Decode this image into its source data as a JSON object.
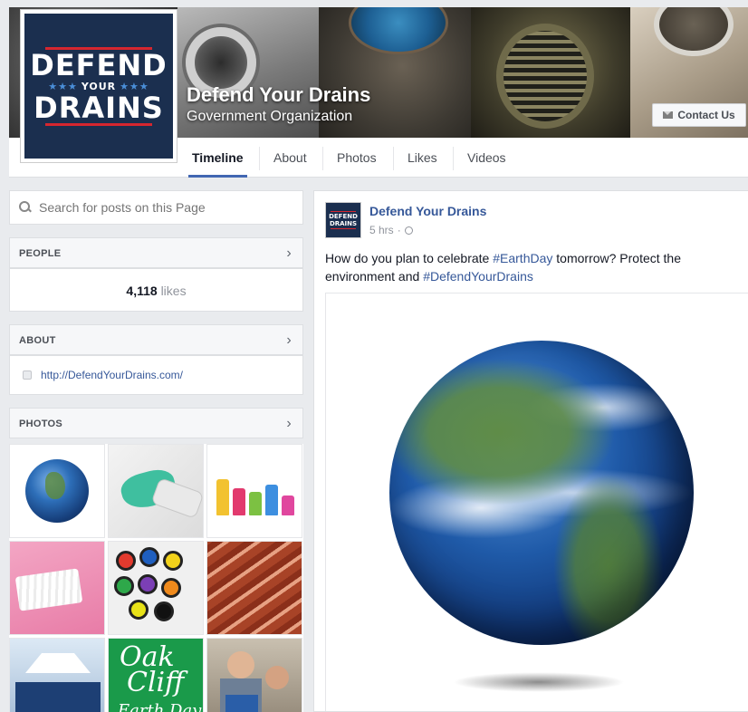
{
  "page": {
    "name": "Defend Your Drains",
    "category": "Government Organization",
    "contact_label": "Contact Us",
    "logo": {
      "line1": "DEFEND",
      "line2": "YOUR",
      "line3": "DRAINS",
      "stars": "★★★"
    }
  },
  "tabs": [
    {
      "label": "Timeline",
      "active": true
    },
    {
      "label": "About"
    },
    {
      "label": "Photos"
    },
    {
      "label": "Likes"
    },
    {
      "label": "Videos"
    }
  ],
  "sidebar": {
    "search_placeholder": "Search for posts on this Page",
    "people": {
      "title": "PEOPLE",
      "count": "4,118",
      "count_label": "likes"
    },
    "about": {
      "title": "ABOUT",
      "website": "http://DefendYourDrains.com/"
    },
    "photos": {
      "title": "PHOTOS",
      "oak_cliff": {
        "line1": "Oak",
        "line2": "Cliff",
        "line3": "Earth Day"
      }
    }
  },
  "post": {
    "author": "Defend Your Drains",
    "time": "5 hrs",
    "text_before": "How do you plan to celebrate ",
    "hashtag1": "#EarthDay",
    "text_middle": " tomorrow? Protect the environment and ",
    "hashtag2": "#DefendYourDrains",
    "avatar": {
      "line1": "DEFEND",
      "line2": "DRAINS"
    }
  },
  "colors": {
    "brand_navy": "#1b2f4f",
    "brand_red": "#d6262f",
    "link_blue": "#365899",
    "tab_underline": "#4267b2"
  },
  "icons": {
    "search": "search-icon",
    "chevron": "chevron-right-icon",
    "website": "globe-icon",
    "contact": "envelope-icon",
    "privacy": "public-globe-icon"
  }
}
